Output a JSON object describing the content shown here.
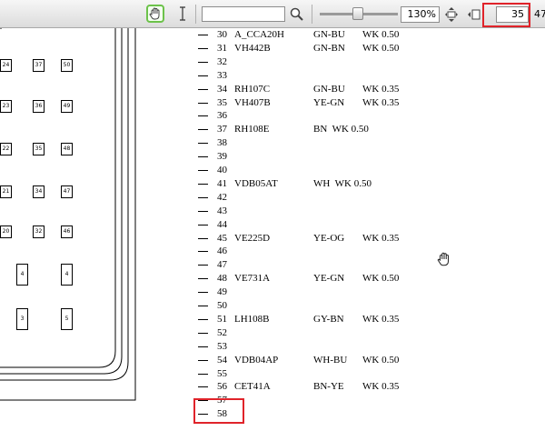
{
  "toolbar": {
    "hand_tool": "hand-tool",
    "select_tool": "text-select-tool",
    "search_value": "",
    "zoom_level": "130%",
    "zoom_slider_fraction": 0.45,
    "page_current": "35",
    "page_total": "47",
    "highlight_color": "#e0232a"
  },
  "drawing": {
    "cells_col1": [
      "24",
      "23",
      "22",
      "21",
      "20"
    ],
    "cells_col2": [
      "37",
      "36",
      "35",
      "34",
      "32"
    ],
    "cells_col3": [
      "50",
      "49",
      "48",
      "47",
      "46"
    ],
    "small_left": [
      "4",
      "3"
    ],
    "small_right": [
      "4",
      "5"
    ]
  },
  "pins": [
    {
      "num": "30",
      "code": "A_CCA20H",
      "color": "GN-BU",
      "wk": "WK 0.50"
    },
    {
      "num": "31",
      "code": "VH442B",
      "color": "GN-BN",
      "wk": "WK 0.50"
    },
    {
      "num": "32",
      "code": "",
      "color": "",
      "wk": ""
    },
    {
      "num": "33",
      "code": "",
      "color": "",
      "wk": ""
    },
    {
      "num": "34",
      "code": "RH107C",
      "color": "GN-BU",
      "wk": "WK 0.35"
    },
    {
      "num": "35",
      "code": "VH407B",
      "color": "YE-GN",
      "wk": "WK 0.35"
    },
    {
      "num": "36",
      "code": "",
      "color": "",
      "wk": ""
    },
    {
      "num": "37",
      "code": "RH108E",
      "color": "BN  WK 0.50",
      "wk": ""
    },
    {
      "num": "38",
      "code": "",
      "color": "",
      "wk": ""
    },
    {
      "num": "39",
      "code": "",
      "color": "",
      "wk": ""
    },
    {
      "num": "40",
      "code": "",
      "color": "",
      "wk": ""
    },
    {
      "num": "41",
      "code": "VDB05AT",
      "color": "WH  WK 0.50",
      "wk": ""
    },
    {
      "num": "42",
      "code": "",
      "color": "",
      "wk": ""
    },
    {
      "num": "43",
      "code": "",
      "color": "",
      "wk": ""
    },
    {
      "num": "44",
      "code": "",
      "color": "",
      "wk": ""
    },
    {
      "num": "45",
      "code": "VE225D",
      "color": "YE-OG",
      "wk": "WK 0.35"
    },
    {
      "num": "46",
      "code": "",
      "color": "",
      "wk": ""
    },
    {
      "num": "47",
      "code": "",
      "color": "",
      "wk": ""
    },
    {
      "num": "48",
      "code": "VE731A",
      "color": "YE-GN",
      "wk": "WK 0.50"
    },
    {
      "num": "49",
      "code": "",
      "color": "",
      "wk": ""
    },
    {
      "num": "50",
      "code": "",
      "color": "",
      "wk": ""
    },
    {
      "num": "51",
      "code": "LH108B",
      "color": "GY-BN",
      "wk": "WK 0.35"
    },
    {
      "num": "52",
      "code": "",
      "color": "",
      "wk": ""
    },
    {
      "num": "53",
      "code": "",
      "color": "",
      "wk": ""
    },
    {
      "num": "54",
      "code": "VDB04AP",
      "color": "WH-BU",
      "wk": "WK 0.50"
    },
    {
      "num": "55",
      "code": "",
      "color": "",
      "wk": ""
    },
    {
      "num": "56",
      "code": "CET41A",
      "color": "BN-YE",
      "wk": "WK 0.35"
    },
    {
      "num": "57",
      "code": "",
      "color": "",
      "wk": ""
    },
    {
      "num": "58",
      "code": "",
      "color": "",
      "wk": ""
    }
  ]
}
